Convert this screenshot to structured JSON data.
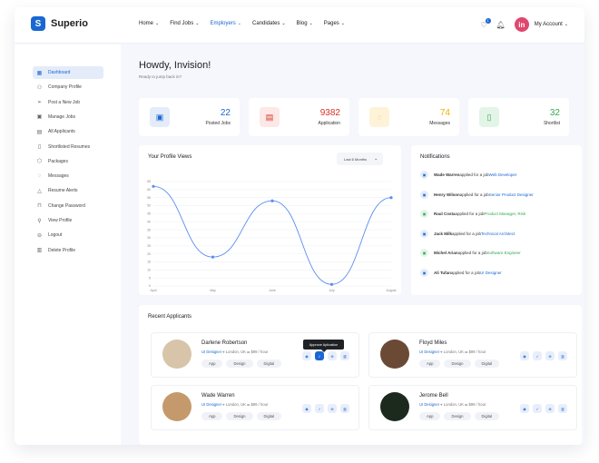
{
  "brand": {
    "name": "Superio",
    "logo_letter": "S"
  },
  "nav": [
    "Home",
    "Find Jobs",
    "Employers",
    "Candidates",
    "Blog",
    "Pages"
  ],
  "nav_active": "Employers",
  "header": {
    "account_label": "My Account",
    "avatar_letter": "in",
    "notif_count": "1"
  },
  "sidebar": {
    "items": [
      {
        "label": "Dashboard",
        "icon": "grid-icon"
      },
      {
        "label": "Company Profile",
        "icon": "user-icon"
      },
      {
        "label": "Post a New Job",
        "icon": "send-icon"
      },
      {
        "label": "Manage Jobs",
        "icon": "briefcase-icon"
      },
      {
        "label": "All Applicants",
        "icon": "file-icon"
      },
      {
        "label": "Shortlisted Resumes",
        "icon": "bookmark-icon"
      },
      {
        "label": "Packages",
        "icon": "package-icon"
      },
      {
        "label": "Messages",
        "icon": "chat-icon"
      },
      {
        "label": "Resume Alerts",
        "icon": "bell-icon"
      },
      {
        "label": "Change Password",
        "icon": "lock-icon"
      },
      {
        "label": "View Profile",
        "icon": "profile-icon"
      },
      {
        "label": "Logout",
        "icon": "logout-icon"
      },
      {
        "label": "Delete Profile",
        "icon": "trash-icon"
      }
    ]
  },
  "greeting": {
    "title": "Howdy, Invision!",
    "subtitle": "Ready to jump back in?"
  },
  "stats": [
    {
      "value": "22",
      "label": "Posted Jobs",
      "color": "#1967d2",
      "bg": "#e4ecfa",
      "icon": "briefcase-icon"
    },
    {
      "value": "9382",
      "label": "Application",
      "color": "#d93025",
      "bg": "#fce8e6",
      "icon": "document-icon"
    },
    {
      "value": "74",
      "label": "Messages",
      "color": "#f9ab00",
      "bg": "#fef3d9",
      "icon": "chat-icon"
    },
    {
      "value": "32",
      "label": "Shortlist",
      "color": "#34a853",
      "bg": "#e3f4e8",
      "icon": "bookmark-icon"
    }
  ],
  "profile_views": {
    "title": "Your Profile Views",
    "dropdown": "Last 6 Months"
  },
  "chart_data": {
    "type": "line",
    "x": [
      "April",
      "May",
      "June",
      "July",
      "August"
    ],
    "y_ticks": [
      0,
      5,
      10,
      15,
      20,
      25,
      30,
      35,
      40,
      45,
      50,
      55,
      60,
      65
    ],
    "values": [
      62,
      18,
      53,
      1,
      55
    ],
    "ylim": [
      0,
      65
    ],
    "color": "#5b8def"
  },
  "notifications": {
    "title": "Notifications",
    "items": [
      {
        "name": "Wade Warren",
        "text": "applied for a job",
        "job": "Web Developer",
        "color": "#1967d2",
        "bg": "#e4ecfa"
      },
      {
        "name": "Henry Wilson",
        "text": "applied for a job",
        "job": "Senior Product Designer",
        "color": "#1967d2",
        "bg": "#e4ecfa"
      },
      {
        "name": "Raul Costa",
        "text": "applied for a job",
        "job": "Product Manager, Risk",
        "color": "#34a853",
        "bg": "#e3f4e8"
      },
      {
        "name": "Jack Milk",
        "text": "applied for a job",
        "job": "Technical Architect",
        "color": "#1967d2",
        "bg": "#e4ecfa"
      },
      {
        "name": "Michel Arian",
        "text": "applied for a job",
        "job": "Software Engineer",
        "color": "#34a853",
        "bg": "#e3f4e8"
      },
      {
        "name": "Ali Tufan",
        "text": "applied for a job",
        "job": "UI Designer",
        "color": "#1967d2",
        "bg": "#e4ecfa"
      }
    ]
  },
  "applicants": {
    "title": "Recent Applicants",
    "tooltip": "Approve Aplication",
    "items": [
      {
        "name": "Darlene Robertson",
        "role": "UI Designer",
        "location": "London, UK",
        "pay": "$99 / hour",
        "tags": [
          "App",
          "Design",
          "Digital"
        ],
        "photo_bg": "#d8c4a8"
      },
      {
        "name": "Floyd Miles",
        "role": "UI Designer",
        "location": "London, UK",
        "pay": "$99 / hour",
        "tags": [
          "App",
          "Design",
          "Digital"
        ],
        "photo_bg": "#6b4a35"
      },
      {
        "name": "Wade Warren",
        "role": "UI Designer",
        "location": "London, UK",
        "pay": "$99 / hour",
        "tags": [
          "App",
          "Design",
          "Digital"
        ],
        "photo_bg": "#c49a6c"
      },
      {
        "name": "Jerome Bell",
        "role": "UI Designer",
        "location": "London, UK",
        "pay": "$99 / hour",
        "tags": [
          "App",
          "Design",
          "Digital"
        ],
        "photo_bg": "#1c2a1e"
      }
    ]
  }
}
